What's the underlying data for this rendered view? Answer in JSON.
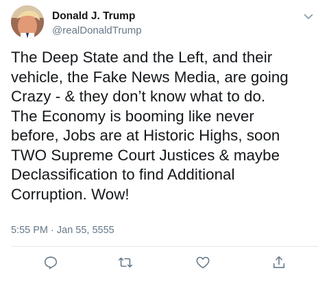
{
  "user": {
    "display_name": "Donald J. Trump",
    "handle": "@realDonaldTrump"
  },
  "tweet": {
    "text": "The Deep State and the Left, and their\nvehicle, the Fake News Media, are going\nCrazy - & they don’t know what to do.\nThe Economy is booming like never\nbefore, Jobs are at Historic Highs, soon\nTWO Supreme Court Justices & maybe\nDeclassification to find Additional\nCorruption. Wow!",
    "timestamp": "5:55 PM · Jan 55, 5555"
  },
  "icons": {
    "menu": "chevron-down-icon",
    "reply": "reply-icon",
    "retweet": "retweet-icon",
    "like": "heart-icon",
    "share": "share-icon"
  },
  "colors": {
    "text": "#14171a",
    "secondary": "#657786",
    "divider": "#e1e8ed"
  }
}
